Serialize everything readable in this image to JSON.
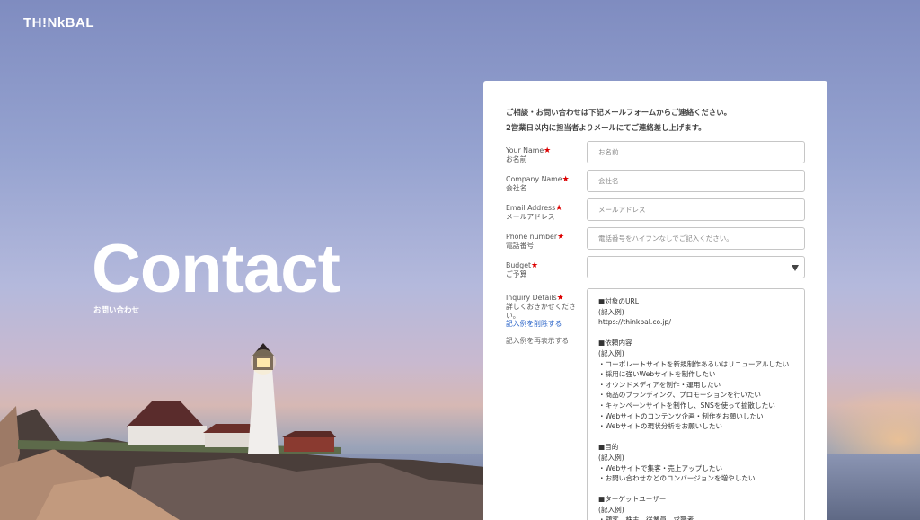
{
  "brand": {
    "logo_text": "TH!NkBAL"
  },
  "hero": {
    "title": "Contact",
    "subtitle": "お問い合わせ"
  },
  "form": {
    "intro_line1": "ご相談・お問い合わせは下記メールフォームからご連絡ください。",
    "intro_line2": "2営業日以内に担当者よりメールにてご連絡差し上げます。",
    "required_mark": "★",
    "name": {
      "label_en": "Your Name",
      "label_ja": "お名前",
      "placeholder": "お名前"
    },
    "company": {
      "label_en": "Company Name",
      "label_ja": "会社名",
      "placeholder": "会社名"
    },
    "email": {
      "label_en": "Email Address",
      "label_ja": "メールアドレス",
      "placeholder": "メールアドレス"
    },
    "phone": {
      "label_en": "Phone number",
      "label_ja": "電話番号",
      "placeholder": "電話番号をハイフンなしでご記入ください。"
    },
    "budget": {
      "label_en": "Budget",
      "label_ja": "ご予算",
      "value": ""
    },
    "inquiry": {
      "label_en": "Inquiry Details",
      "label_ja": "詳しくおきかせください。",
      "delete_example_link": "記入例を削除する",
      "redisplay_example_link": "記入例を再表示する",
      "value": "■対象のURL\n(記入例)\nhttps://thinkbal.co.jp/\n\n■依頼内容\n(記入例)\n・コーポレートサイトを新規制作あるいはリニューアルしたい\n・採用に強いWebサイトを制作したい\n・オウンドメディアを制作・運用したい\n・商品のブランディング、プロモーションを行いたい\n・キャンペーンサイトを制作し、SNSを使って拡散したい\n・Webサイトのコンテンツ企画・制作をお願いしたい\n・Webサイトの現状分析をお願いしたい\n\n■目的\n(記入例)\n・Webサイトで集客・売上アップしたい\n・お問い合わせなどのコンバージョンを増やしたい\n\n■ターゲットユーザー\n(記入例)\n・顧客、株主、従業員、求職者"
    }
  }
}
